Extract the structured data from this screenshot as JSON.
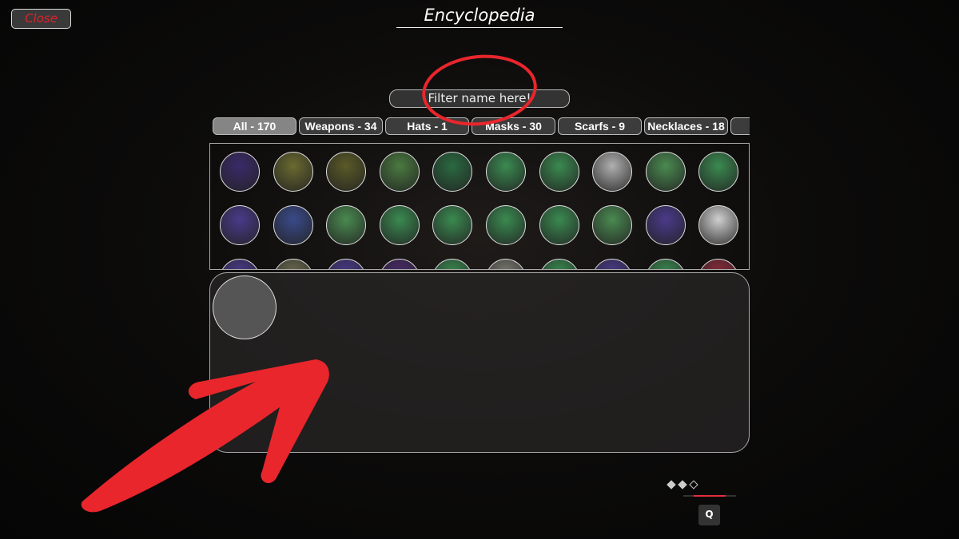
{
  "header": {
    "close_label": "Close",
    "title": "Encyclopedia"
  },
  "filter": {
    "placeholder": "Filter name here!"
  },
  "tabs": [
    {
      "label": "All - 170",
      "active": true
    },
    {
      "label": "Weapons - 34"
    },
    {
      "label": "Hats - 1"
    },
    {
      "label": "Masks - 30"
    },
    {
      "label": "Scarfs - 9"
    },
    {
      "label": "Necklaces - 18"
    },
    {
      "label": ""
    }
  ],
  "items": [
    {
      "icon": "dark-robe-icon",
      "bg": "#3a2a6a"
    },
    {
      "icon": "white-pants-icon",
      "bg": "#6a6a30"
    },
    {
      "icon": "rock-cloak-icon",
      "bg": "#5a5a28"
    },
    {
      "icon": "lantern-icon",
      "bg": "#4a7a40"
    },
    {
      "icon": "black-mask-icon",
      "bg": "#2a6a40"
    },
    {
      "icon": "necklace-icon",
      "bg": "#3a8a50"
    },
    {
      "icon": "sword-icon",
      "bg": "#3a8a50"
    },
    {
      "icon": "armor-icon",
      "bg": "#b0b0b0"
    },
    {
      "icon": "scarf-icon",
      "bg": "#4a8a50"
    },
    {
      "icon": "white-scarf-icon",
      "bg": "#3a8a50"
    },
    {
      "icon": "rabbit-mask-icon",
      "bg": "#4a3a8a"
    },
    {
      "icon": "crossed-swords-icon",
      "bg": "#3a4a8a"
    },
    {
      "icon": "necklace-icon",
      "bg": "#4a8a50"
    },
    {
      "icon": "hood-icon",
      "bg": "#3a8a50"
    },
    {
      "icon": "hat-icon",
      "bg": "#3a8a50"
    },
    {
      "icon": "red-cloak-icon",
      "bg": "#3a8a50"
    },
    {
      "icon": "dark-cloak-icon",
      "bg": "#3a8a50"
    },
    {
      "icon": "necklace-icon",
      "bg": "#4a8a50"
    },
    {
      "icon": "red-cube-icon",
      "bg": "#4a3a8a"
    },
    {
      "icon": "fox-mask-icon",
      "bg": "#d0d0d0"
    },
    {
      "icon": "crystal-icon",
      "bg": "#4a3a8a"
    },
    {
      "icon": "item-icon",
      "bg": "#6a6a50"
    },
    {
      "icon": "item-icon",
      "bg": "#4a3a8a"
    },
    {
      "icon": "item-icon",
      "bg": "#4a2a6a"
    },
    {
      "icon": "item-icon",
      "bg": "#3a8a50"
    },
    {
      "icon": "item-icon",
      "bg": "#7a7a70"
    },
    {
      "icon": "item-icon",
      "bg": "#3a8a50"
    },
    {
      "icon": "item-icon",
      "bg": "#4a3a8a"
    },
    {
      "icon": "item-icon",
      "bg": "#3a8a50"
    },
    {
      "icon": "item-icon",
      "bg": "#8a2a3a"
    }
  ],
  "hud": {
    "charges": [
      true,
      true,
      false
    ],
    "progress": 0.6,
    "key": "Q",
    "accent": "#e0303a"
  },
  "annotation_color": "#e8262c"
}
